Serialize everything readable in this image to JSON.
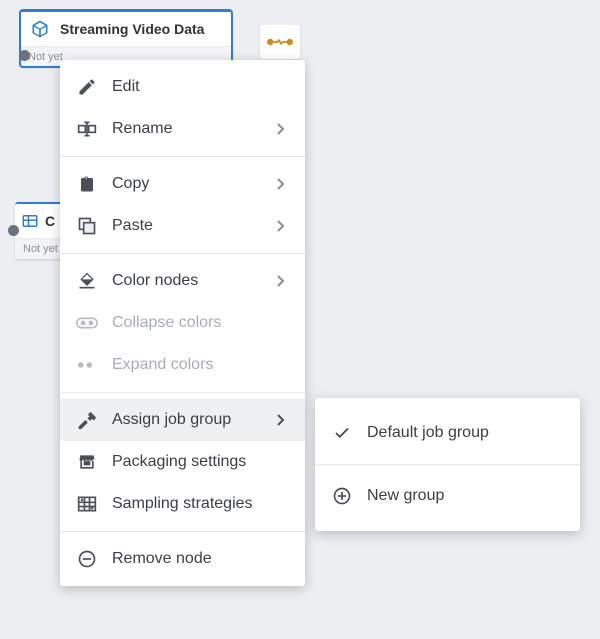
{
  "nodes": {
    "streaming": {
      "title": "Streaming Video Data",
      "status": "Not yet"
    },
    "partial": {
      "title": "C",
      "status": "Not yet"
    }
  },
  "context_menu": {
    "edit": "Edit",
    "rename": "Rename",
    "copy": "Copy",
    "paste": "Paste",
    "color_nodes": "Color nodes",
    "collapse_colors": "Collapse colors",
    "expand_colors": "Expand colors",
    "assign_job_group": "Assign job group",
    "packaging_settings": "Packaging settings",
    "sampling_strategies": "Sampling strategies",
    "remove_node": "Remove node"
  },
  "submenu": {
    "default_job_group": "Default job group",
    "new_group": "New group"
  }
}
